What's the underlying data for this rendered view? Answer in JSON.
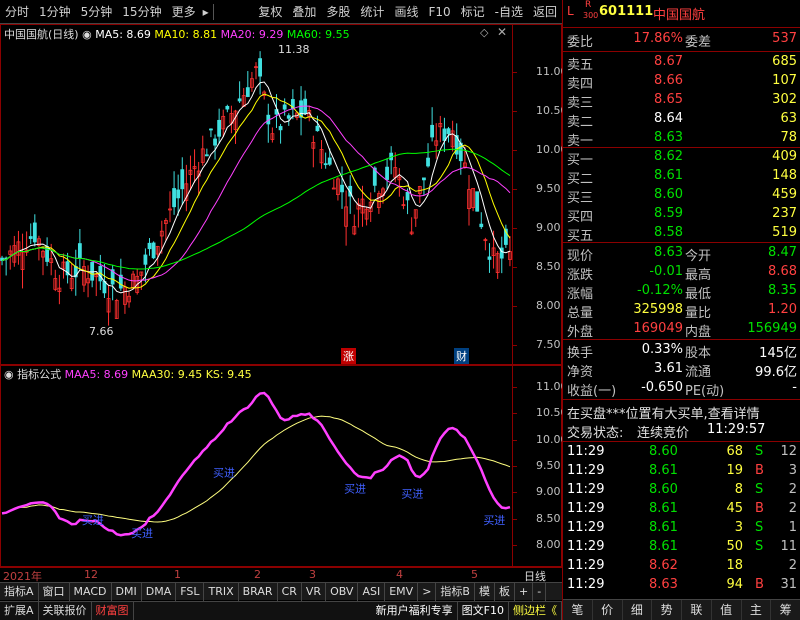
{
  "toolbar": {
    "items": [
      "分时",
      "1分钟",
      "5分钟",
      "15分钟",
      "更多",
      "复权",
      "叠加",
      "多股",
      "统计",
      "画线",
      "F10",
      "标记",
      "-自选",
      "返回"
    ]
  },
  "main_chart": {
    "stock_label": "中国国航(日线)",
    "ma5": "MA5: 8.69",
    "ma10": "MA10: 8.81",
    "ma20": "MA20: 9.29",
    "ma60": "MA60: 9.55",
    "high_label": "11.38",
    "low_label": "7.66",
    "marker_zhang": "涨",
    "marker_cai": "财",
    "yticks": [
      "11.00",
      "10.50",
      "10.00",
      "9.50",
      "9.00",
      "8.50",
      "8.00",
      "7.50"
    ],
    "colors": {
      "ma5": "#ffffff",
      "ma10": "#ffff00",
      "ma20": "#ff40ff",
      "ma60": "#00ff00",
      "up": "#ff3030",
      "down": "#40e0e0"
    }
  },
  "sub_chart": {
    "title": "指标公式",
    "maa5": "MAA5: 8.69",
    "maa30": "MAA30: 9.45",
    "ks": "KS: 9.45",
    "buy_label": "买进",
    "yticks": [
      "11.00",
      "10.50",
      "10.00",
      "9.50",
      "9.00",
      "8.50",
      "8.00"
    ]
  },
  "x_axis": {
    "labels": [
      "2021年",
      "12",
      "1",
      "2",
      "3",
      "4",
      "5"
    ],
    "period": "日线"
  },
  "indicator_tabs": [
    "指标A",
    "窗口",
    "MACD",
    "DMI",
    "DMA",
    "FSL",
    "TRIX",
    "BRAR",
    "CR",
    "VR",
    "OBV",
    "ASI",
    "EMV",
    ">",
    "指标B",
    "模",
    "板",
    "+",
    "-"
  ],
  "bottom_left_tabs": [
    "扩展A",
    "关联报价",
    "财富图"
  ],
  "bottom_promo": [
    "新用户福利专享",
    "图文F10",
    "侧边栏《"
  ],
  "quote_panel": {
    "code": "601111",
    "name": "中国国航",
    "badge_l": "L",
    "badge_r": "R",
    "badge_num": "300",
    "weibi_label": "委比",
    "weibi": "17.86%",
    "weicha_label": "委差",
    "weicha": "537",
    "asks": [
      {
        "label": "卖五",
        "price": "8.67",
        "vol": "685"
      },
      {
        "label": "卖四",
        "price": "8.66",
        "vol": "107"
      },
      {
        "label": "卖三",
        "price": "8.65",
        "vol": "302"
      },
      {
        "label": "卖二",
        "price": "8.64",
        "vol": "63"
      },
      {
        "label": "卖一",
        "price": "8.63",
        "vol": "78"
      }
    ],
    "bids": [
      {
        "label": "买一",
        "price": "8.62",
        "vol": "409"
      },
      {
        "label": "买二",
        "price": "8.61",
        "vol": "148"
      },
      {
        "label": "买三",
        "price": "8.60",
        "vol": "459"
      },
      {
        "label": "买四",
        "price": "8.59",
        "vol": "237"
      },
      {
        "label": "买五",
        "price": "8.58",
        "vol": "519"
      }
    ],
    "stats": [
      {
        "l1": "现价",
        "v1": "8.63",
        "l2": "今开",
        "v2": "8.47"
      },
      {
        "l1": "涨跌",
        "v1": "-0.01",
        "l2": "最高",
        "v2": "8.68"
      },
      {
        "l1": "涨幅",
        "v1": "-0.12%",
        "l2": "最低",
        "v2": "8.35"
      },
      {
        "l1": "总量",
        "v1": "325998",
        "l2": "量比",
        "v2": "1.20"
      },
      {
        "l1": "外盘",
        "v1": "169049",
        "l2": "内盘",
        "v2": "156949"
      }
    ],
    "stats2": [
      {
        "l1": "换手",
        "v1": "0.33%",
        "l2": "股本",
        "v2": "145亿"
      },
      {
        "l1": "净资",
        "v1": "3.61",
        "l2": "流通",
        "v2": "99.6亿"
      },
      {
        "l1": "收益(一)",
        "v1": "-0.650",
        "l2": "PE(动)",
        "v2": "-"
      }
    ],
    "notice": "在买盘***位置有大买单,查看详情",
    "trade_status_label": "交易状态:",
    "trade_status": "连续竞价",
    "trade_time": "11:29:57",
    "ticks": [
      {
        "t": "11:29",
        "p": "8.60",
        "v": "68",
        "bs": "S",
        "n": "12"
      },
      {
        "t": "11:29",
        "p": "8.61",
        "v": "19",
        "bs": "B",
        "n": "3"
      },
      {
        "t": "11:29",
        "p": "8.60",
        "v": "8",
        "bs": "S",
        "n": "2"
      },
      {
        "t": "11:29",
        "p": "8.61",
        "v": "45",
        "bs": "B",
        "n": "2"
      },
      {
        "t": "11:29",
        "p": "8.61",
        "v": "3",
        "bs": "S",
        "n": "1"
      },
      {
        "t": "11:29",
        "p": "8.61",
        "v": "50",
        "bs": "S",
        "n": "11"
      },
      {
        "t": "11:29",
        "p": "8.62",
        "v": "18",
        "bs": "",
        "n": "2"
      },
      {
        "t": "11:29",
        "p": "8.63",
        "v": "94",
        "bs": "B",
        "n": "31"
      }
    ],
    "bottom_tabs": [
      "笔",
      "价",
      "细",
      "势",
      "联",
      "值",
      "主",
      "筹"
    ]
  }
}
